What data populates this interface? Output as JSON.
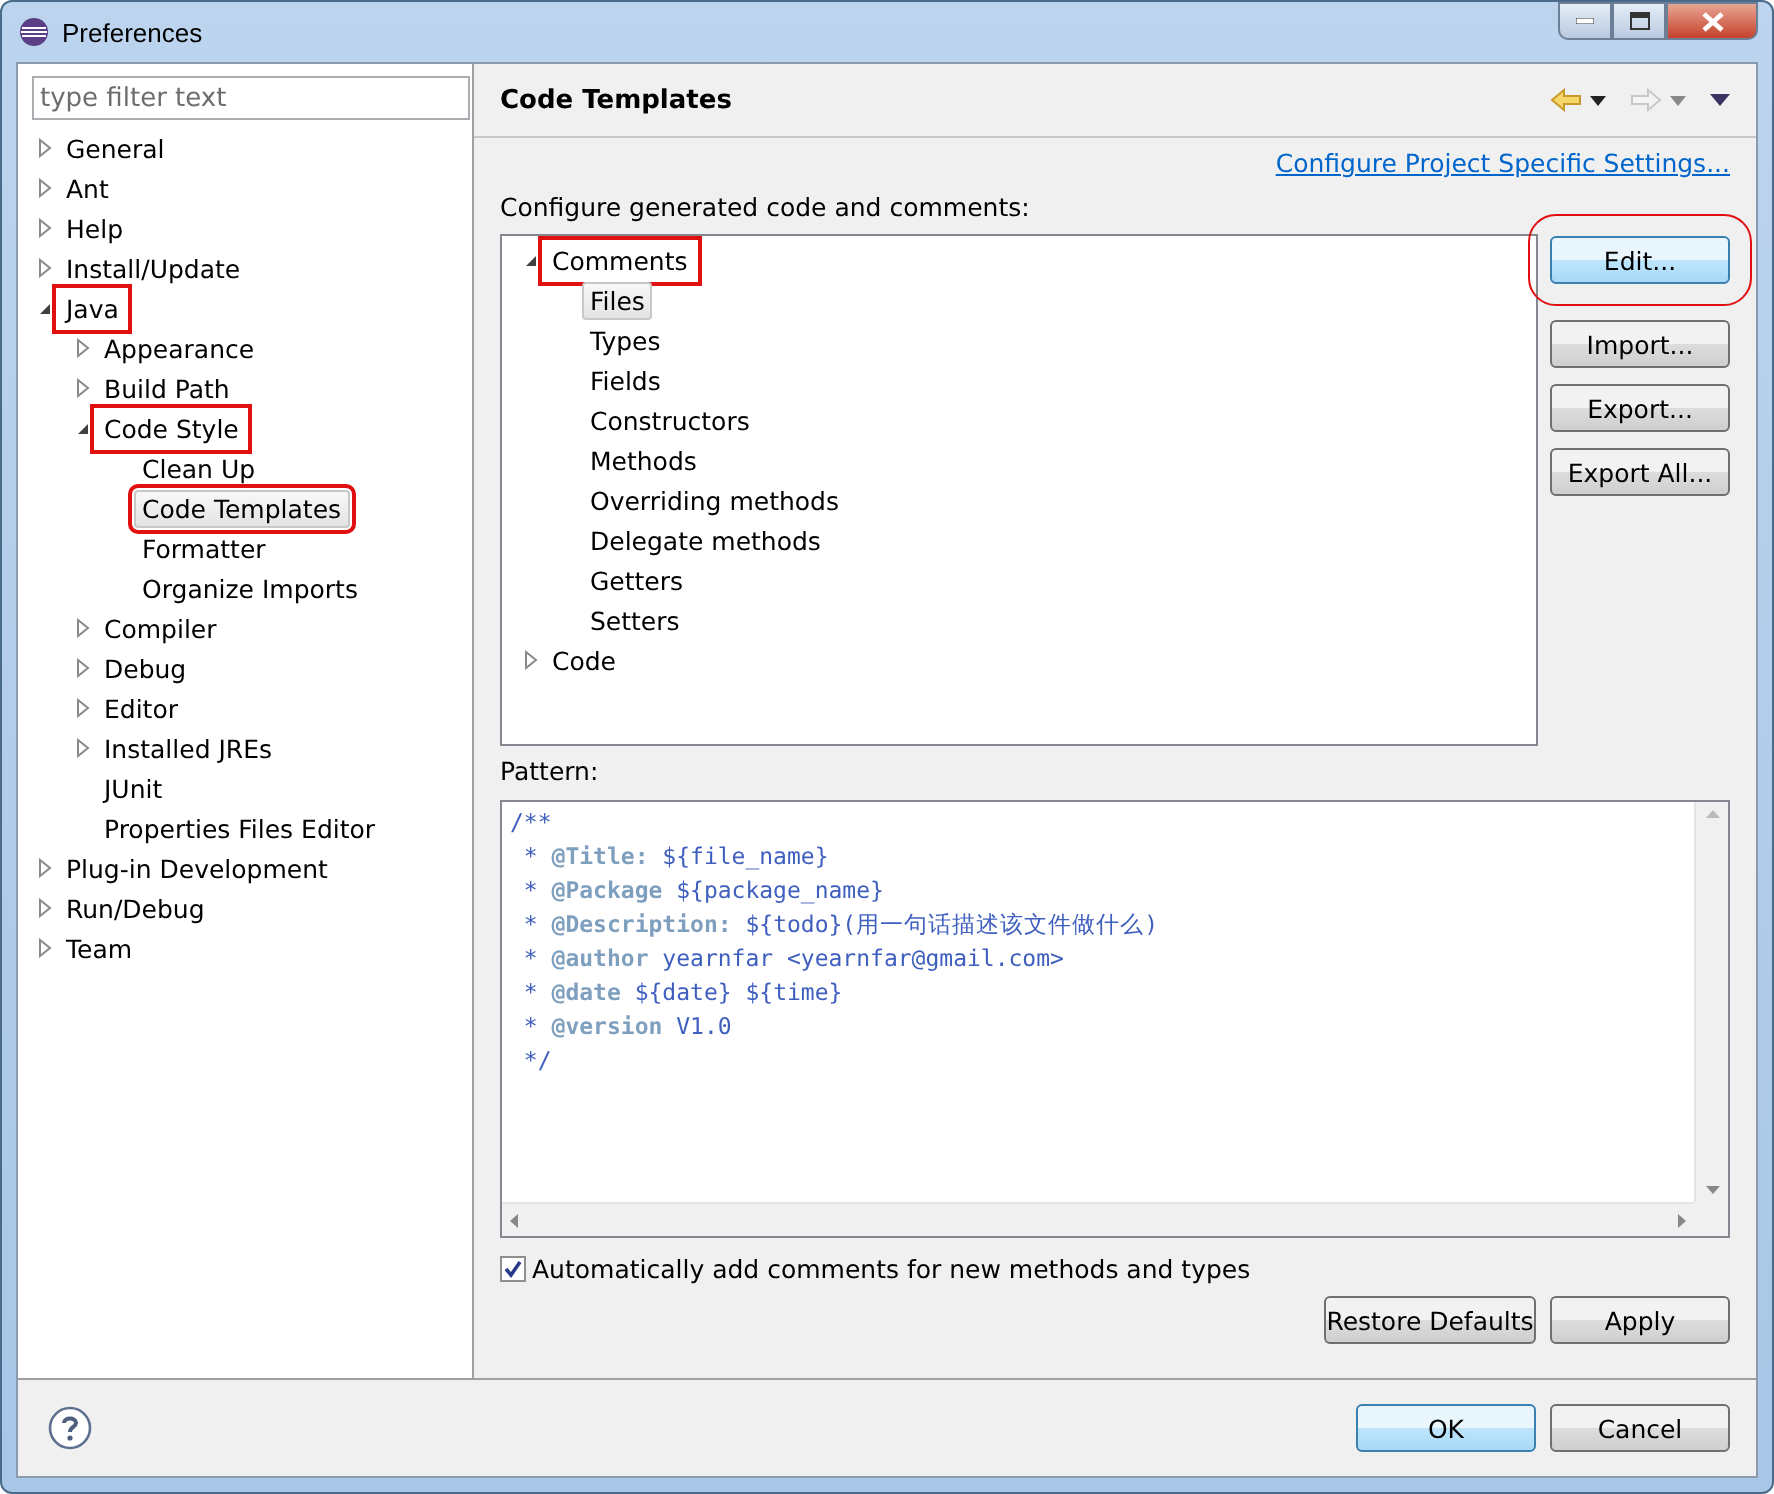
{
  "window": {
    "title": "Preferences"
  },
  "filter": {
    "placeholder": "type filter text"
  },
  "nav_tree": [
    {
      "label": "General",
      "expanded": false,
      "selected": false,
      "annotated": false
    },
    {
      "label": "Ant",
      "expanded": false,
      "selected": false,
      "annotated": false
    },
    {
      "label": "Help",
      "expanded": false,
      "selected": false,
      "annotated": false
    },
    {
      "label": "Install/Update",
      "expanded": false,
      "selected": false,
      "annotated": false
    },
    {
      "label": "Java",
      "expanded": true,
      "selected": false,
      "annotated": true,
      "children": [
        {
          "label": "Appearance",
          "expanded": false,
          "selected": false,
          "annotated": false
        },
        {
          "label": "Build Path",
          "expanded": false,
          "selected": false,
          "annotated": false
        },
        {
          "label": "Code Style",
          "expanded": true,
          "selected": false,
          "annotated": true,
          "children": [
            {
              "label": "Clean Up",
              "selected": false,
              "annotated": false
            },
            {
              "label": "Code Templates",
              "selected": true,
              "annotated": true
            },
            {
              "label": "Formatter",
              "selected": false,
              "annotated": false
            },
            {
              "label": "Organize Imports",
              "selected": false,
              "annotated": false
            }
          ]
        },
        {
          "label": "Compiler",
          "expanded": false,
          "selected": false,
          "annotated": false
        },
        {
          "label": "Debug",
          "expanded": false,
          "selected": false,
          "annotated": false
        },
        {
          "label": "Editor",
          "expanded": false,
          "selected": false,
          "annotated": false
        },
        {
          "label": "Installed JREs",
          "expanded": false,
          "selected": false,
          "annotated": false
        },
        {
          "label": "JUnit",
          "selected": false,
          "annotated": false
        },
        {
          "label": "Properties Files Editor",
          "selected": false,
          "annotated": false
        }
      ]
    },
    {
      "label": "Plug-in Development",
      "expanded": false,
      "selected": false,
      "annotated": false
    },
    {
      "label": "Run/Debug",
      "expanded": false,
      "selected": false,
      "annotated": false
    },
    {
      "label": "Team",
      "expanded": false,
      "selected": false,
      "annotated": false
    }
  ],
  "page": {
    "title": "Code Templates",
    "link": "Configure Project Specific Settings...",
    "description": "Configure generated code and comments:",
    "templates": [
      {
        "label": "Comments",
        "expanded": true,
        "selected": false,
        "annotated": true,
        "children": [
          {
            "label": "Files",
            "selected": true,
            "annotated": false
          },
          {
            "label": "Types",
            "selected": false,
            "annotated": false
          },
          {
            "label": "Fields",
            "selected": false,
            "annotated": false
          },
          {
            "label": "Constructors",
            "selected": false,
            "annotated": false
          },
          {
            "label": "Methods",
            "selected": false,
            "annotated": false
          },
          {
            "label": "Overriding methods",
            "selected": false,
            "annotated": false
          },
          {
            "label": "Delegate methods",
            "selected": false,
            "annotated": false
          },
          {
            "label": "Getters",
            "selected": false,
            "annotated": false
          },
          {
            "label": "Setters",
            "selected": false,
            "annotated": false
          }
        ]
      },
      {
        "label": "Code",
        "expanded": false,
        "selected": false,
        "annotated": false
      }
    ],
    "side_buttons": [
      {
        "label": "Edit...",
        "annotated": true,
        "focused": true
      },
      {
        "label": "Import...",
        "annotated": false,
        "focused": false
      },
      {
        "label": "Export...",
        "annotated": false,
        "focused": false
      },
      {
        "label": "Export All...",
        "annotated": false,
        "focused": false
      }
    ],
    "pattern_label": "Pattern:",
    "pattern_lines": [
      "/**",
      " * **@Title:** ${file_name}",
      " * **@Package** ${package_name}",
      " * **@Description:** ${todo}(用一句话描述该文件做什么)",
      " * **@author** yearnfar <yearnfar@gmail.com>",
      " * **@date** ${date} ${time}",
      " * **@version** V1.0",
      " */"
    ],
    "auto_comments": {
      "label": "Automatically add comments for new methods and types",
      "checked": true
    },
    "buttons": [
      "Restore Defaults",
      "Apply"
    ]
  },
  "dialog_buttons": [
    {
      "label": "OK",
      "focused": true
    },
    {
      "label": "Cancel",
      "focused": false
    }
  ]
}
